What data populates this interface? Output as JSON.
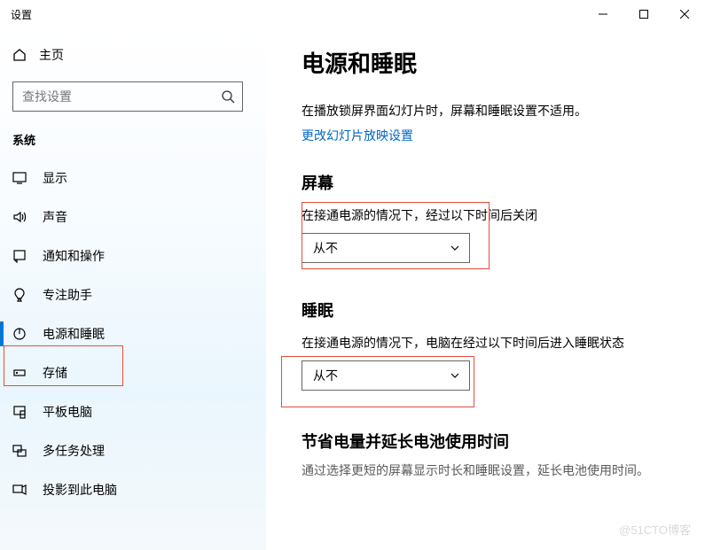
{
  "titlebar": {
    "title": "设置"
  },
  "sidebar": {
    "home": "主页",
    "search_placeholder": "查找设置",
    "section": "系统",
    "items": [
      {
        "label": "显示"
      },
      {
        "label": "声音"
      },
      {
        "label": "通知和操作"
      },
      {
        "label": "专注助手"
      },
      {
        "label": "电源和睡眠"
      },
      {
        "label": "存储"
      },
      {
        "label": "平板电脑"
      },
      {
        "label": "多任务处理"
      },
      {
        "label": "投影到此电脑"
      }
    ]
  },
  "content": {
    "title": "电源和睡眠",
    "note": "在播放锁屏界面幻灯片时，屏幕和睡眠设置不适用。",
    "link": "更改幻灯片放映设置",
    "screen": {
      "heading": "屏幕",
      "label": "在接通电源的情况下，经过以下时间后关闭",
      "value": "从不"
    },
    "sleep": {
      "heading": "睡眠",
      "label": "在接通电源的情况下，电脑在经过以下时间后进入睡眠状态",
      "value": "从不"
    },
    "battery": {
      "heading": "节省电量并延长电池使用时间",
      "desc": "通过选择更短的屏幕显示时长和睡眠设置，延长电池使用时间。"
    }
  },
  "watermark": "@51CTO博客"
}
